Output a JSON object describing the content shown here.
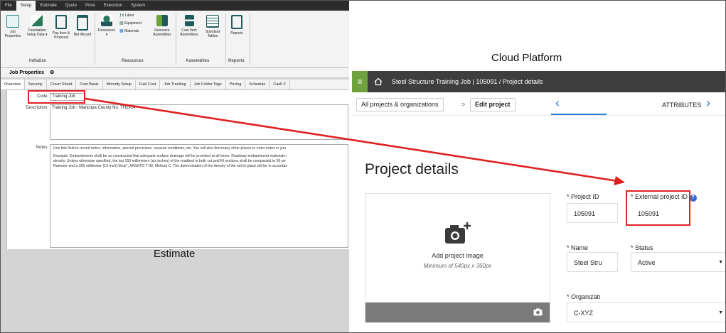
{
  "estimate": {
    "menu": [
      "File",
      "Setup",
      "Estimate",
      "Quote",
      "Price",
      "Execution",
      "System"
    ],
    "ribbon": {
      "buttons": [
        {
          "label": "Job Properties",
          "label2": "",
          "icon": "job-properties-icon"
        },
        {
          "label": "Foundation",
          "label2": "Setup Data ▾",
          "icon": "foundation-setup-icon"
        },
        {
          "label": "Pay Item &",
          "label2": "Proposal",
          "icon": "pay-item-icon"
        },
        {
          "label": "Bid Wizard",
          "label2": "",
          "icon": "bid-wizard-icon"
        },
        {
          "label": "Resources",
          "label2": "▾",
          "icon": "resources-icon"
        },
        {
          "label": "Labor",
          "label2": "",
          "icon": "labor-icon"
        },
        {
          "label": "Equipment",
          "label2": "",
          "icon": "equipment-icon"
        },
        {
          "label": "Materials",
          "label2": "",
          "icon": "materials-icon"
        },
        {
          "label": "Resource",
          "label2": "Assemblies",
          "icon": "resource-assemblies-icon"
        },
        {
          "label": "Cost Item",
          "label2": "Assemblies",
          "icon": "cost-item-assemblies-icon"
        },
        {
          "label": "Standard",
          "label2": "Tables",
          "icon": "standard-tables-icon"
        },
        {
          "label": "Reports",
          "label2": "",
          "icon": "reports-icon"
        }
      ],
      "groups": [
        "Initialize",
        "Resources",
        "Assemblies",
        "Reports"
      ]
    },
    "panel_title": "Job Properties",
    "tabs": [
      "Overview",
      "Security",
      "Cover Sheet",
      "Cost Basis",
      "Minority Setup",
      "Fuel Cost",
      "Job Tracking",
      "Job Folder Tags",
      "Pricing",
      "Schedule",
      "Cash F"
    ],
    "code_label": "Code:",
    "code_value": "Training Job",
    "description_label": "Description:",
    "description_value": "Training Job - Maricopa County No. TH2924",
    "notes_label": "Notes:",
    "notes_line1": "Use this field to record notes, information, special provisions, unusual conditions, etc. You will also find many other places to enter notes in you",
    "notes_line2": "Example:  Embankments shall be so constructed that adequate surface drainage will be provided at all times. Roadway embankment materials i",
    "notes_line3": "density. Unless otherwise specified, the top 150 millimeters (six inches) of the roadbed in both cut and fill sections shall be compacted to 95 pe",
    "notes_line4": "Rammer and a 305 millimeter (12-inch) Drop\", AASHTO T 99, Method C. The determination of the density of the soil in place will be in accordan",
    "caption": "Estimate"
  },
  "cloud": {
    "caption": "Cloud Platform",
    "breadcrumb": "Steel Structure Training Job | 105091  /  Project details",
    "all_projects": "All projects & organizations",
    "edit_project": "Edit project",
    "attributes": "ATTRIBUTES",
    "page_title": "Project details",
    "add_image": "Add project image",
    "image_hint": "Minimum of 540px x 360px",
    "project_id_label": "* Project ID",
    "project_id_value": "105091",
    "external_id_label": "* External project ID",
    "external_id_value": "105091",
    "name_label": "* Name",
    "name_value": "Steel Stru",
    "status_label": "* Status",
    "status_value": "Active",
    "org_label": "* Organizati",
    "org_value": "C-XYZ"
  },
  "colors": {
    "arrow": "#e02020",
    "appbar": "#3e3e3e",
    "hamburger": "#6fa13c",
    "link_blue": "#2a7dd1"
  }
}
